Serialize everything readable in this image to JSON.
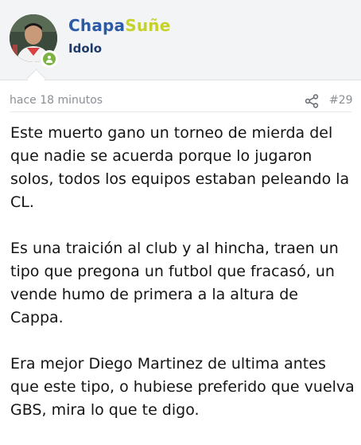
{
  "post": {
    "author": {
      "name_part1": "Chapa",
      "name_part2": "Suñe",
      "title": "Idolo",
      "name_color_1": "#2c5ba5",
      "name_color_2": "#c6d12a",
      "online_color": "#7cb342"
    },
    "timestamp": "hace 18 minutos",
    "share_icon": "share-icon",
    "post_number": "#29",
    "paragraphs": [
      "Este muerto gano un torneo de mierda del que nadie se acuerda porque lo jugaron solos, todos los equipos estaban peleando la CL.",
      "Es una traición al club y al hincha, traen un tipo que pregona un futbol que fracasó, un vende humo de primera a la altura de Cappa.",
      "Era mejor Diego Martinez de ultima antes que este tipo, o hubiese preferido que vuelva GBS, mira lo que te digo."
    ]
  }
}
